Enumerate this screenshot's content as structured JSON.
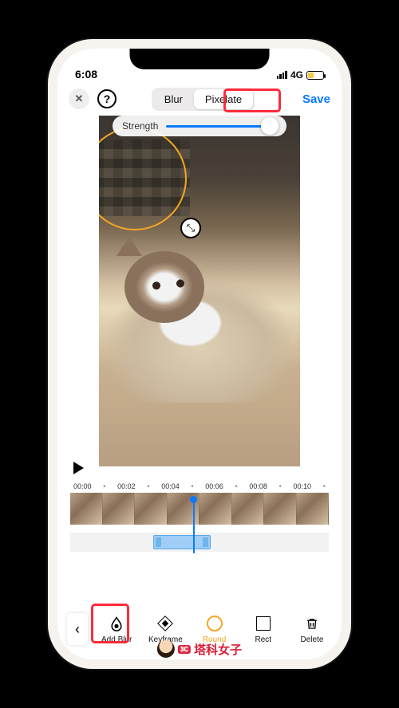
{
  "status": {
    "time": "6:08",
    "network": "4G"
  },
  "topbar": {
    "close_symbol": "✕",
    "help_symbol": "?",
    "seg_blur": "Blur",
    "seg_pixelate": "Pixelate",
    "save": "Save"
  },
  "strength": {
    "label": "Strength",
    "value": 100
  },
  "timeline": {
    "labels": [
      "00:00",
      "00:02",
      "00:04",
      "00:06",
      "00:08",
      "00:10"
    ]
  },
  "toolbar": {
    "back": "‹",
    "add_blur": "Add Blur",
    "keyframe": "Keyframe",
    "round": "Round",
    "rect": "Rect",
    "delete": "Delete"
  },
  "resize_glyph": "⤡",
  "watermark": {
    "badge": "3C",
    "text": "塔科女子"
  }
}
